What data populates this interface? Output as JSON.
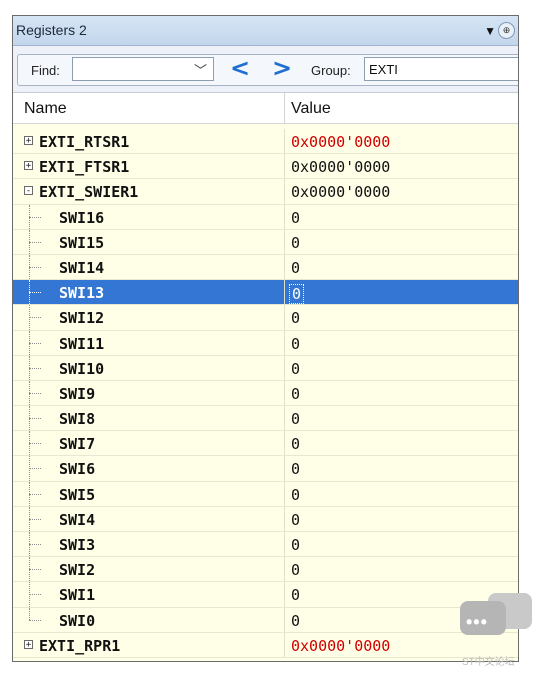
{
  "window": {
    "title": "Registers 2"
  },
  "toolbar": {
    "find_label": "Find:",
    "find_value": "",
    "group_label": "Group:",
    "group_value": "EXTI"
  },
  "columns": {
    "name": "Name",
    "value": "Value"
  },
  "rows": [
    {
      "name": "EXTI_RTSR1",
      "value": "0x0000'0000",
      "level": 0,
      "toggle": "+",
      "changed": true
    },
    {
      "name": "EXTI_FTSR1",
      "value": "0x0000'0000",
      "level": 0,
      "toggle": "+",
      "changed": false
    },
    {
      "name": "EXTI_SWIER1",
      "value": "0x0000'0000",
      "level": 0,
      "toggle": "-",
      "changed": false
    },
    {
      "name": "SWI16",
      "value": "0",
      "level": 1
    },
    {
      "name": "SWI15",
      "value": "0",
      "level": 1
    },
    {
      "name": "SWI14",
      "value": "0",
      "level": 1
    },
    {
      "name": "SWI13",
      "value": "0",
      "level": 1,
      "selected": true
    },
    {
      "name": "SWI12",
      "value": "0",
      "level": 1
    },
    {
      "name": "SWI11",
      "value": "0",
      "level": 1
    },
    {
      "name": "SWI10",
      "value": "0",
      "level": 1
    },
    {
      "name": "SWI9",
      "value": "0",
      "level": 1
    },
    {
      "name": "SWI8",
      "value": "0",
      "level": 1
    },
    {
      "name": "SWI7",
      "value": "0",
      "level": 1
    },
    {
      "name": "SWI6",
      "value": "0",
      "level": 1
    },
    {
      "name": "SWI5",
      "value": "0",
      "level": 1
    },
    {
      "name": "SWI4",
      "value": "0",
      "level": 1
    },
    {
      "name": "SWI3",
      "value": "0",
      "level": 1
    },
    {
      "name": "SWI2",
      "value": "0",
      "level": 1
    },
    {
      "name": "SWI1",
      "value": "0",
      "level": 1
    },
    {
      "name": "SWI0",
      "value": "0",
      "level": 1,
      "last_child": true
    },
    {
      "name": "EXTI_RPR1",
      "value": "0x0000'0000",
      "level": 0,
      "toggle": "+",
      "changed": true
    }
  ],
  "colors": {
    "changed_value": "#d00000",
    "selection": "#3376d4",
    "panel_background": "#ffffe8"
  },
  "watermark": {
    "text": "ST中文论坛"
  }
}
